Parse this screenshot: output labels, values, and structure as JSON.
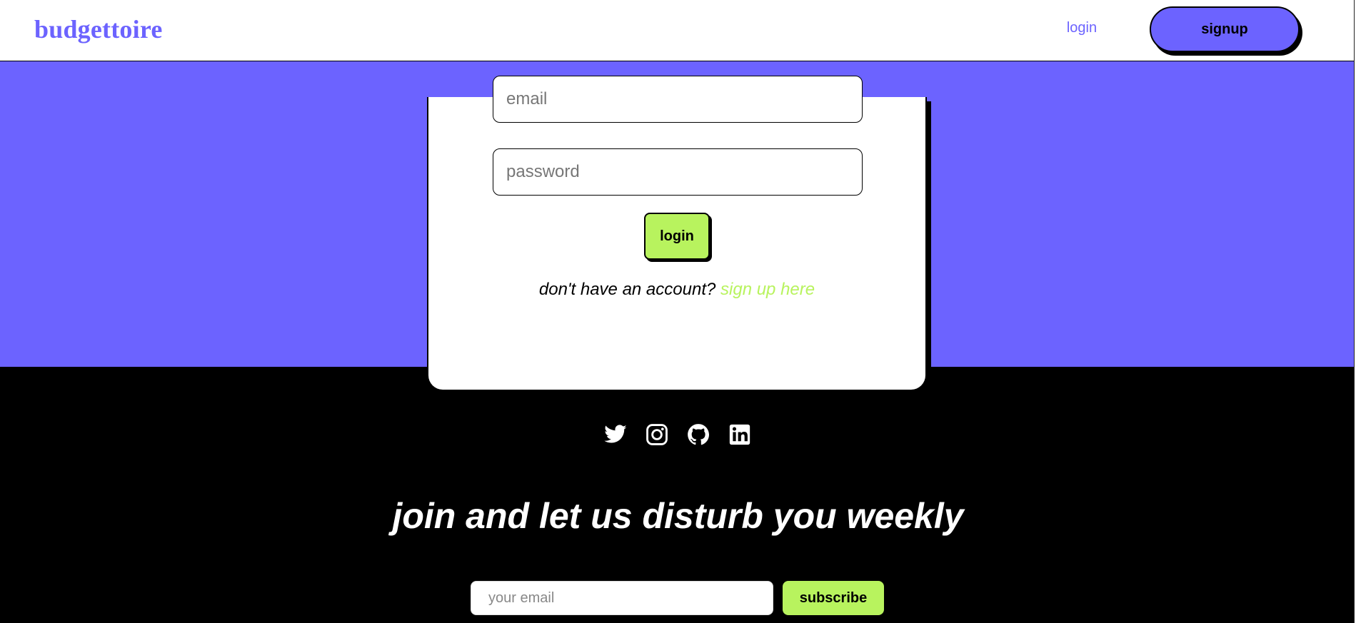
{
  "header": {
    "brand": "budgettoire",
    "nav": {
      "login_label": "login",
      "signup_label": "signup"
    }
  },
  "login_form": {
    "email_placeholder": "email",
    "password_placeholder": "password",
    "submit_label": "login",
    "signup_prompt": "don't have an account?",
    "signup_link": "sign up here"
  },
  "footer": {
    "social_icons": [
      "twitter-icon",
      "instagram-icon",
      "github-icon",
      "linkedin-icon"
    ],
    "tagline": "join and let us disturb you weekly",
    "newsletter": {
      "placeholder": "your email",
      "button_label": "subscribe"
    }
  },
  "colors": {
    "brand": "#6c63ff",
    "accent": "#b8f35e",
    "footer_bg": "#000000"
  }
}
